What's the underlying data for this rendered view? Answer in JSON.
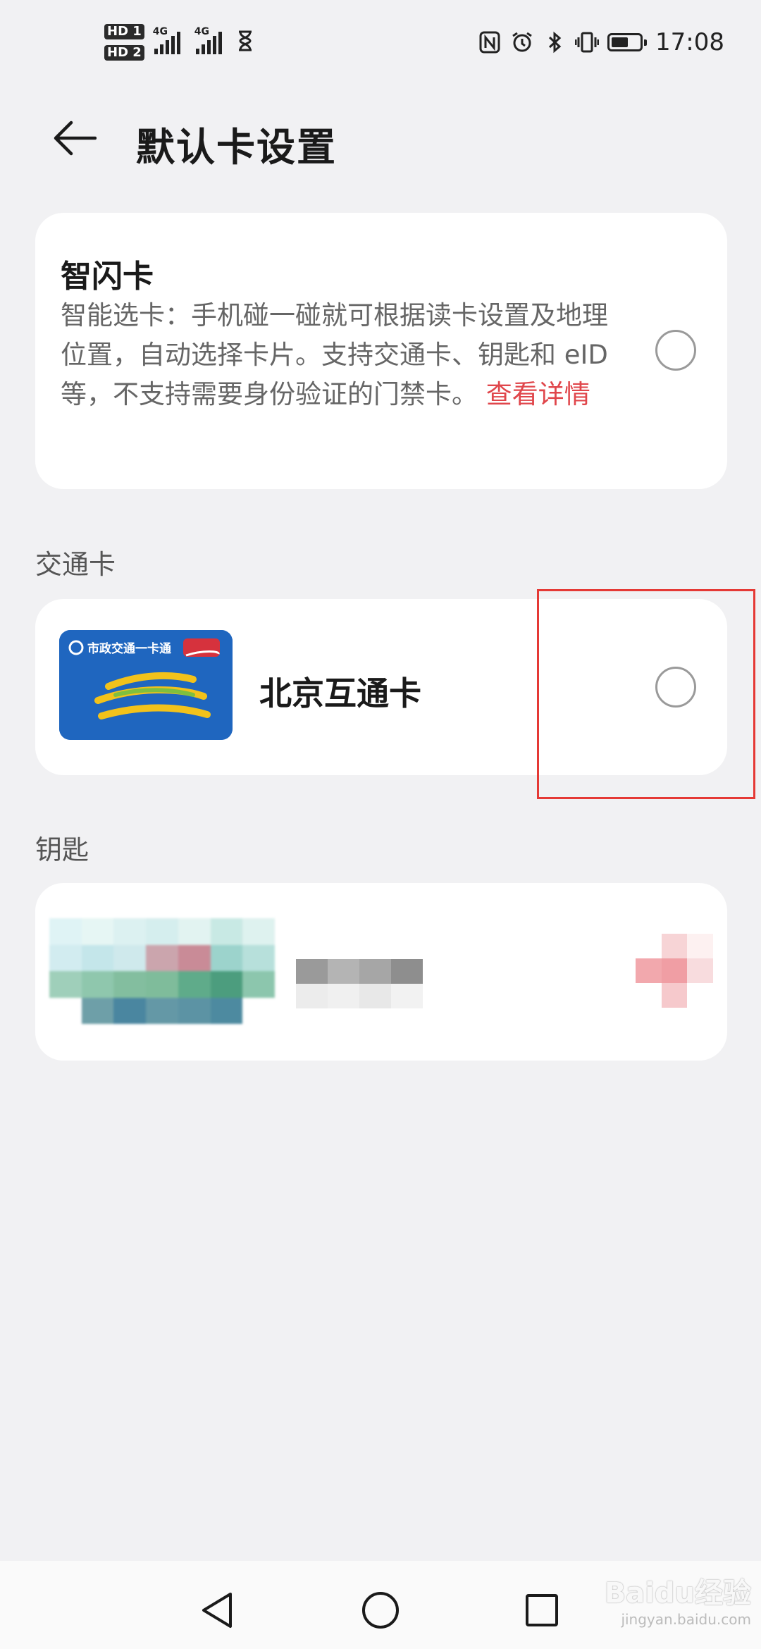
{
  "status_bar": {
    "sim1": "HD 1",
    "sim2": "HD 2",
    "network1": "4G",
    "network2": "4G",
    "time": "17:08",
    "battery_level": 0.6,
    "icons": [
      "nfc-icon",
      "alarm-icon",
      "bluetooth-icon",
      "vibrate-icon",
      "battery-icon"
    ]
  },
  "header": {
    "title": "默认卡设置"
  },
  "smart_card": {
    "title": "智闪卡",
    "description": "智能选卡：手机碰一碰就可根据读卡设置及地理位置，自动选择卡片。支持交通卡、钥匙和 eID 等，不支持需要身份验证的门禁卡。",
    "details_link": "查看详情",
    "selected": false
  },
  "transit_section": {
    "label": "交通卡",
    "card": {
      "name": "北京互通卡",
      "image_text": "市政交通一卡通",
      "selected": false
    }
  },
  "key_section": {
    "label": "钥匙"
  },
  "colors": {
    "background": "#f1f1f3",
    "card": "#ffffff",
    "link": "#e0464b",
    "highlight": "#e53935",
    "transit_card": "#1f66bf"
  },
  "watermark": {
    "text": "Baidu经验",
    "sub": "jingyan.baidu.com"
  }
}
